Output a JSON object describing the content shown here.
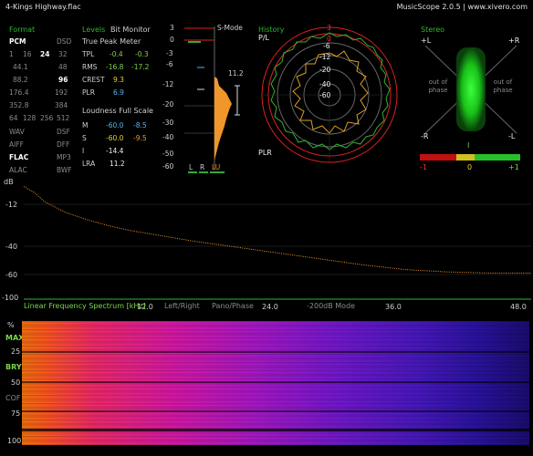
{
  "window": {
    "file_title": "4-Kings Highway.flac",
    "brand": "MusicScope 2.0.5 | www.xivero.com"
  },
  "format": {
    "header": "Format",
    "pcm": "PCM",
    "dsd": "DSD",
    "bits": [
      "1",
      "16",
      "24",
      "32"
    ],
    "rates": [
      [
        "44.1",
        "48"
      ],
      [
        "88.2",
        "96"
      ],
      [
        "176.4",
        "192"
      ],
      [
        "352.8",
        "384"
      ]
    ],
    "dsd_rates": [
      "64",
      "128",
      "256",
      "512"
    ],
    "containers": [
      [
        "WAV",
        "DSF"
      ],
      [
        "AIFF",
        "DFF"
      ],
      [
        "FLAC",
        "MP3"
      ],
      [
        "ALAC",
        "BWF"
      ]
    ]
  },
  "levels": {
    "header": "Levels",
    "bitmonitor": "Bit Monitor",
    "tp_header": "True Peak Meter",
    "rows": [
      {
        "label": "TPL",
        "l": "-0.4",
        "r": "-0.3"
      },
      {
        "label": "RMS",
        "l": "-16.8",
        "r": "-17.2"
      },
      {
        "label": "CREST",
        "l": "9.3",
        "r": ""
      },
      {
        "label": "PLR",
        "l": "6.9",
        "r": ""
      }
    ],
    "loud_header": "Loudness Full Scale",
    "loud_rows": [
      {
        "label": "M",
        "a": "-60.0",
        "b": "-8.5"
      },
      {
        "label": "S",
        "a": "-60.0",
        "b": "-9.5"
      },
      {
        "label": "I",
        "a": "-14.4",
        "b": ""
      },
      {
        "label": "LRA",
        "a": "11.2",
        "b": ""
      }
    ]
  },
  "meter": {
    "smode": "S-Mode",
    "scale": [
      "3",
      "0",
      "-3",
      "-6",
      "-12",
      "-20",
      "-30",
      "-40",
      "-50",
      "-60"
    ],
    "peak_value": "11.2",
    "buttons": [
      "L",
      "R",
      "LU"
    ]
  },
  "history": {
    "header": "History",
    "pl": "P/L",
    "plr": "PLR",
    "rings": [
      "-6",
      "-12",
      "-20",
      "-40",
      "-60"
    ]
  },
  "stereo": {
    "header": "Stereo",
    "corners": [
      "+L",
      "+R",
      "-R",
      "-L"
    ],
    "out_left": "out of phase",
    "out_right": "out of phase",
    "corr_marker": "I",
    "corr_scale": [
      "-1",
      "0",
      "+1"
    ]
  },
  "spectrum": {
    "db_label": "dB",
    "y_ticks": [
      "-12",
      "-40",
      "-60",
      "-100"
    ],
    "x_ticks": [
      "12.0",
      "24.0",
      "36.0",
      "48.0"
    ],
    "title": "Linear Frequency Spectrum [kHz]",
    "modes": [
      "Left/Right",
      "Pano/Phase",
      "-200dB Mode"
    ]
  },
  "spectrogram": {
    "y_labels": [
      "%",
      "MAX",
      "25",
      "BRY",
      "50",
      "COF",
      "75",
      "100"
    ]
  },
  "chart_data": {
    "type": "line",
    "xlabel": "Linear Frequency Spectrum [kHz]",
    "ylabel": "dB",
    "xlim": [
      0,
      48
    ],
    "ylim": [
      -100,
      0
    ],
    "series": [
      {
        "x": [
          0,
          1,
          2,
          4,
          6,
          8,
          10,
          12,
          16,
          20,
          24,
          28,
          32,
          36,
          40,
          44,
          48
        ],
        "values": [
          -5,
          -10,
          -18,
          -27,
          -33,
          -38,
          -42,
          -45,
          -51,
          -56,
          -61,
          -66,
          -71,
          -75,
          -77,
          -78,
          -78
        ]
      }
    ]
  }
}
